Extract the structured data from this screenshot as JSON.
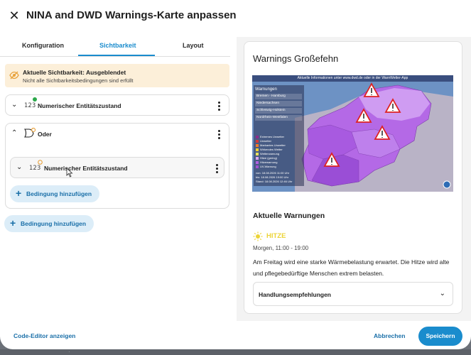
{
  "dialog": {
    "title": "NINA and DWD Warnings-Karte anpassen",
    "close_icon": "close-icon"
  },
  "tabs": [
    {
      "label": "Konfiguration"
    },
    {
      "label": "Sichtbarkeit",
      "active": true
    },
    {
      "label": "Layout"
    }
  ],
  "visibility": {
    "title": "Aktuelle Sichtbarkeit: Ausgeblendet",
    "subtitle": "Nicht alle Sichtbarkeitsbedingungen sind erfüllt",
    "icon": "eye-off-icon"
  },
  "conditions": {
    "row1": {
      "icon_text": "123",
      "label": "Numerischer Entitätszustand",
      "status_color": "#2ba84a"
    },
    "row2": {
      "label": "Oder",
      "status_color": "#e59a2f"
    },
    "row2_child": {
      "icon_text": "123",
      "label": "Numerischer Entitätszustand",
      "status_color": "#e59a2f"
    },
    "add_inner": "Bedingung hinzufügen",
    "add_outer": "Bedingung hinzufügen"
  },
  "preview": {
    "title": "Warnings Großefehn",
    "map": {
      "caption": "Aktuelle Informationen unter www.dwd.de oder in der WarnWetter-App",
      "panel_title": "Warnungen",
      "regions": [
        "Bremen - Hamburg",
        "Niedersachsen",
        "Schleswig-Holstein",
        "Nordrhein-Westfalen"
      ],
      "legend": [
        {
          "label": "Extremes Unwetter",
          "color": "#8c2a8c"
        },
        {
          "label": "Unwetter",
          "color": "#d43a3a"
        },
        {
          "label": "Markantes Unwetter",
          "color": "#f07a2a"
        },
        {
          "label": "Wirkendes Wetter",
          "color": "#f0d030"
        },
        {
          "label": "Wetterwarnung",
          "color": "#e8e060"
        },
        {
          "label": "Hitze (gering)",
          "color": "#d8a4f0"
        },
        {
          "label": "Hitzewarnung",
          "color": "#b060e0"
        },
        {
          "label": "UV-Warnung",
          "color": "#a050d0"
        }
      ],
      "dates": [
        {
          "label": "von:",
          "value": "18.08.2026 11:00 Uhr"
        },
        {
          "label": "bis:",
          "value": "18.08.2026 19:00 Uhr"
        },
        {
          "label": "Stand:",
          "value": "18.08.2026 12:46 Uhr"
        }
      ]
    },
    "current_title": "Aktuelle Warnungen",
    "warning": {
      "title": "HITZE",
      "title_color": "#ecd437",
      "time": "Morgen, 11:00 - 19:00",
      "description": "Am Freitag wird eine starke Wärmebelastung erwartet. Die Hitze wird alte und pflegebedürftige Menschen extrem belasten.",
      "icon": "sun-icon"
    },
    "accordion": "Handlungsempfehlungen"
  },
  "footer": {
    "code_editor": "Code-Editor anzeigen",
    "cancel": "Abbrechen",
    "save": "Speichern"
  },
  "colors": {
    "accent": "#1a8ccd",
    "banner_bg": "#fcefd9",
    "warning_purple": "#b469e6"
  }
}
